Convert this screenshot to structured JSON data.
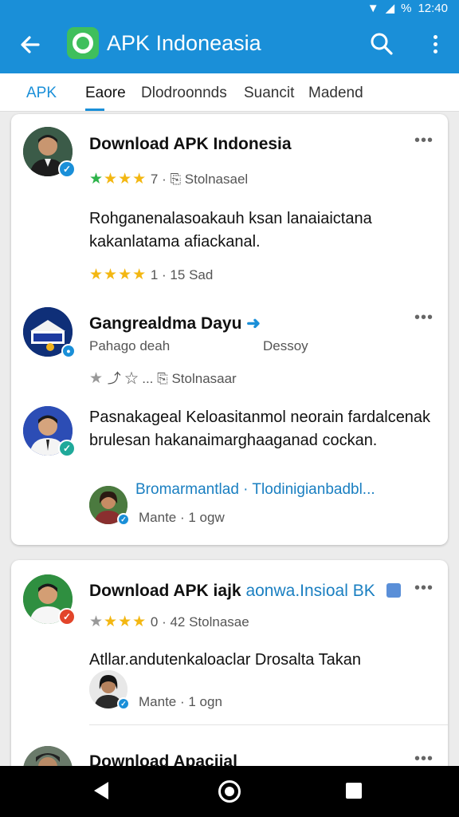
{
  "status_bar": {
    "time": "12:40",
    "battery": "%"
  },
  "app_bar": {
    "title": "APK Indoneasia"
  },
  "tabs": [
    {
      "label": "APK"
    },
    {
      "label": "Eaore"
    },
    {
      "label": "Dlodroonnds"
    },
    {
      "label": "Suancit"
    },
    {
      "label": "Madend"
    }
  ],
  "cards": [
    {
      "posts": [
        {
          "title": "Download APK Indonesia",
          "stars": "★★★★",
          "meta": "7 · ⎘ Stolnasael",
          "body": "Rohganenalasoakauh ksan lanaiaictana kakanlatama afiackanal.",
          "sub_meta": "1 · 15 Sad"
        },
        {
          "title": "Gangrealdma Dayu",
          "title_suffix": "➜",
          "subtitle_left": "Pahago deah",
          "subtitle_right": "Dessoy",
          "meta_actions": "⤴ ☆ ...  ⎘ Stolnasaar"
        },
        {
          "body": "Pasnakageal Keloasitanmol neorain fardalcenak brulesan hakanaimarghaaganad cockan.",
          "reply": {
            "link": "Bromarmantlad · Tlodinigianbadbl...",
            "meta": "Mante · 1 ogw"
          }
        }
      ]
    },
    {
      "posts": [
        {
          "title": "Download APK iajk",
          "title_link": "aonwa.Insioal BK",
          "stars": "★★★★",
          "meta": "0 · 42 Stolnasae",
          "body": "Atllar.andutenkaloaclar Drosalta Takan",
          "reply_meta": "Mante · 1 ogn"
        },
        {
          "title": "Download Apacijal"
        }
      ]
    }
  ],
  "colors": {
    "primary": "#1a8fd8",
    "star_yellow": "#f3b712",
    "star_green": "#2db34a",
    "badge_blue": "#1a8fd8",
    "badge_teal": "#1fa99a",
    "badge_red": "#e2452a"
  },
  "icons": [
    "back-arrow-icon",
    "search-icon",
    "more-vert-icon",
    "verified-badge-icon",
    "share-icon",
    "star-icon",
    "nav-back-icon",
    "nav-home-icon",
    "nav-recent-icon"
  ]
}
